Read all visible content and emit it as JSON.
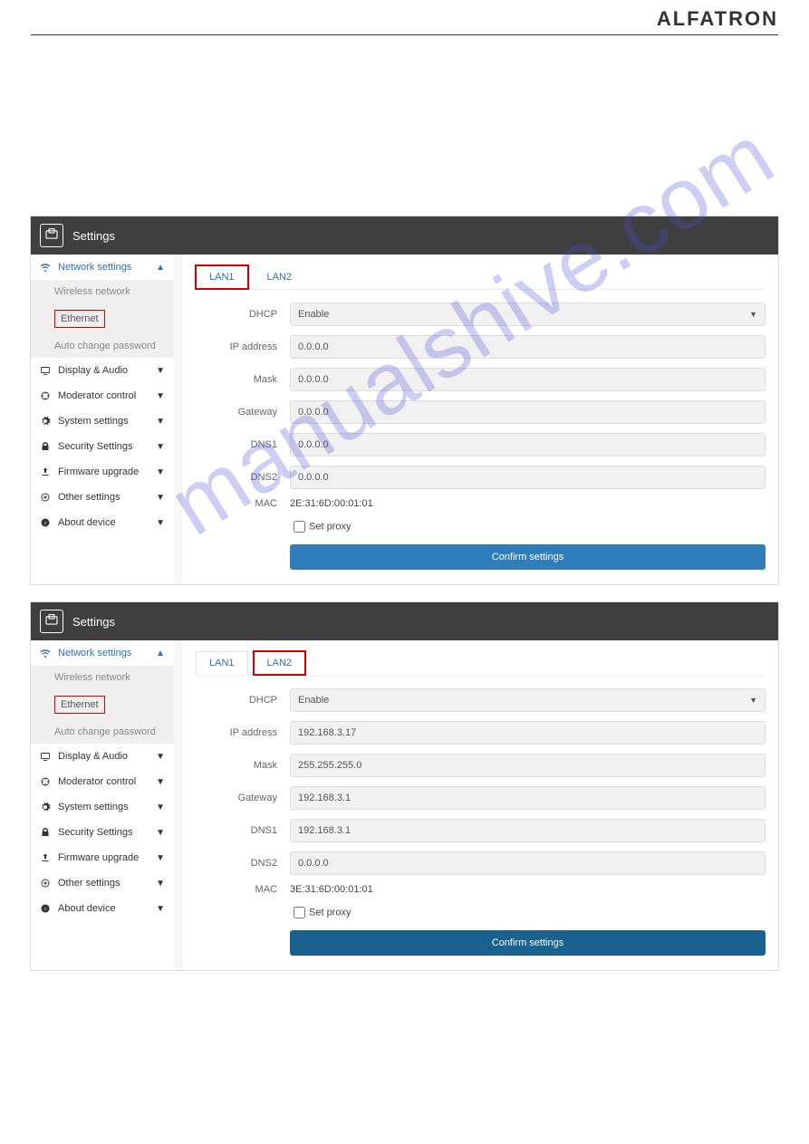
{
  "brand": "ALFATRON",
  "watermark": "manualshive.com",
  "panels": [
    {
      "title": "Settings",
      "sidebar": {
        "network_label": "Network settings",
        "wireless_label": "Wireless network",
        "ethernet_label": "Ethernet",
        "autochange_label": "Auto change password",
        "display_label": "Display & Audio",
        "moderator_label": "Moderator control",
        "system_label": "System settings",
        "security_label": "Security Settings",
        "firmware_label": "Firmware upgrade",
        "other_label": "Other settings",
        "about_label": "About device"
      },
      "tabs": {
        "lan1": "LAN1",
        "lan2": "LAN2",
        "active": "lan1",
        "highlighted": "lan1"
      },
      "form": {
        "dhcp_label": "DHCP",
        "dhcp_value": "Enable",
        "ip_label": "IP address",
        "ip_value": "0.0.0.0",
        "mask_label": "Mask",
        "mask_value": "0.0.0.0",
        "gateway_label": "Gateway",
        "gateway_value": "0.0.0.0",
        "dns1_label": "DNS1",
        "dns1_value": "0.0.0.0",
        "dns2_label": "DNS2",
        "dns2_value": "0.0.0.0",
        "mac_label": "MAC",
        "mac_value": "2E:31:6D:00:01:01",
        "setproxy_label": "Set proxy",
        "confirm_label": "Confirm settings"
      }
    },
    {
      "title": "Settings",
      "sidebar": {
        "network_label": "Network settings",
        "wireless_label": "Wireless network",
        "ethernet_label": "Ethernet",
        "autochange_label": "Auto change password",
        "display_label": "Display & Audio",
        "moderator_label": "Moderator control",
        "system_label": "System settings",
        "security_label": "Security Settings",
        "firmware_label": "Firmware upgrade",
        "other_label": "Other settings",
        "about_label": "About device"
      },
      "tabs": {
        "lan1": "LAN1",
        "lan2": "LAN2",
        "active": "lan1",
        "highlighted": "lan2"
      },
      "form": {
        "dhcp_label": "DHCP",
        "dhcp_value": "Enable",
        "ip_label": "IP address",
        "ip_value": "192.168.3.17",
        "mask_label": "Mask",
        "mask_value": "255.255.255.0",
        "gateway_label": "Gateway",
        "gateway_value": "192.168.3.1",
        "dns1_label": "DNS1",
        "dns1_value": "192.168.3.1",
        "dns2_label": "DNS2",
        "dns2_value": "0.0.0.0",
        "mac_label": "MAC",
        "mac_value": "3E:31:6D:00:01:01",
        "setproxy_label": "Set proxy",
        "confirm_label": "Confirm settings"
      }
    }
  ]
}
